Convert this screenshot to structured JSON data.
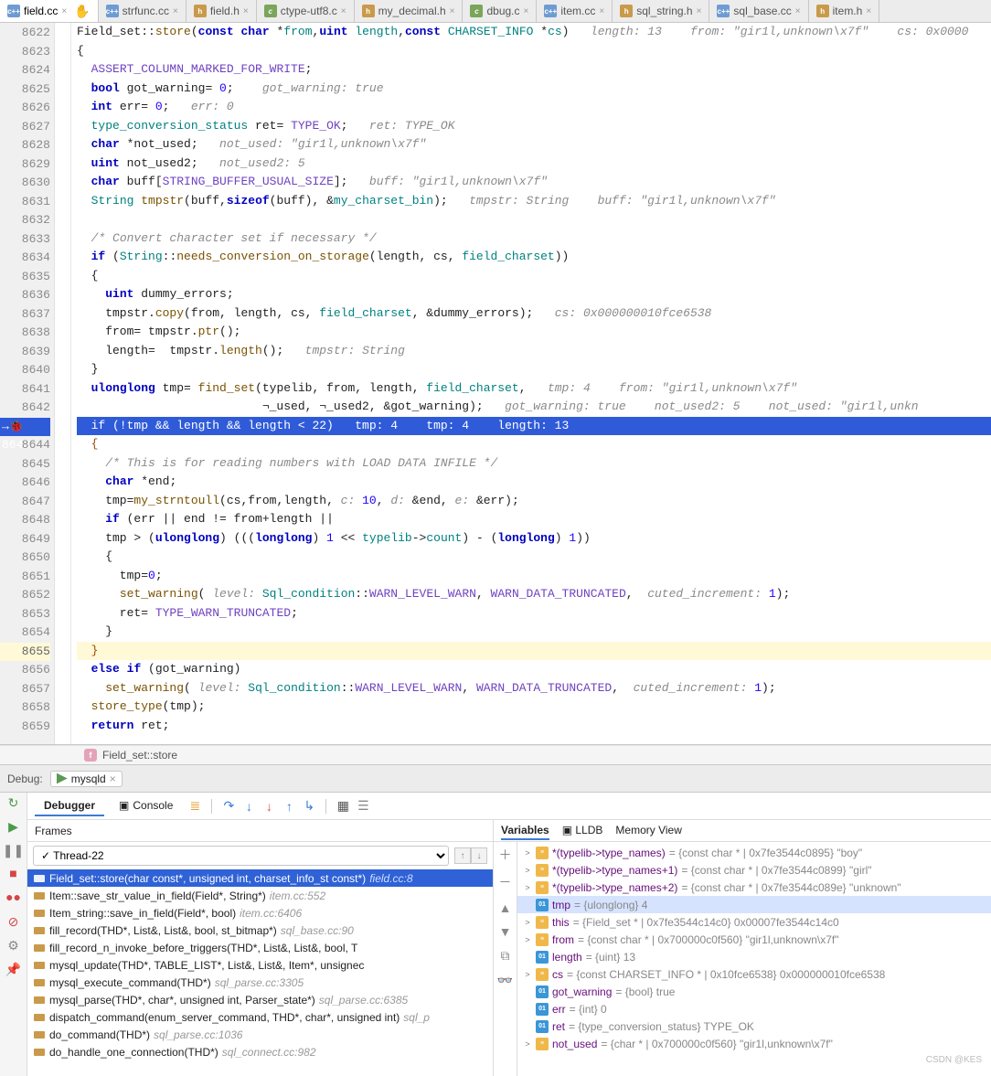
{
  "tabs": [
    {
      "kind": "cpp",
      "label": "field.cc",
      "mod": true,
      "active": true
    },
    {
      "kind": "cpp",
      "label": "strfunc.cc"
    },
    {
      "kind": "h",
      "label": "field.h"
    },
    {
      "kind": "c",
      "label": "ctype-utf8.c"
    },
    {
      "kind": "h",
      "label": "my_decimal.h"
    },
    {
      "kind": "c",
      "label": "dbug.c"
    },
    {
      "kind": "cpp",
      "label": "item.cc"
    },
    {
      "kind": "h",
      "label": "sql_string.h"
    },
    {
      "kind": "cpp",
      "label": "sql_base.cc"
    },
    {
      "kind": "h",
      "label": "item.h"
    }
  ],
  "lines": {
    "start": 8622,
    "count": 38,
    "highlight": 8643,
    "caret": 8655
  },
  "code": [
    {
      "h": "Field_set::<span class='fn'>store</span>(<span class='k'>const</span> <span class='k'>char</span> *<span class='t'>from</span>,<span class='k'>uint</span> <span class='t'>length</span>,<span class='k'>const</span> <span class='t'>CHARSET_INFO</span> *<span class='t'>cs</span>)   <span class='c'>length: 13</span>    <span class='c'>from: \"gir1l,unknown\\x7f\"</span>    <span class='c'>cs: 0x0000</span>"
    },
    {
      "h": "{"
    },
    {
      "h": "  <span class='m'>ASSERT_COLUMN_MARKED_FOR_WRITE</span>;"
    },
    {
      "h": "  <span class='k'>bool</span> got_warning= <span class='n'>0</span>;    <span class='c'>got_warning: true</span>"
    },
    {
      "h": "  <span class='k'>int</span> err= <span class='n'>0</span>;   <span class='c'>err: 0</span>"
    },
    {
      "h": "  <span class='t'>type_conversion_status</span> ret= <span class='m'>TYPE_OK</span>;   <span class='c'>ret: TYPE_OK</span>"
    },
    {
      "h": "  <span class='k'>char</span> *not_used;   <span class='c'>not_used: \"gir1l,unknown\\x7f\"</span>"
    },
    {
      "h": "  <span class='k'>uint</span> not_used2;   <span class='c'>not_used2: 5</span>"
    },
    {
      "h": "  <span class='k'>char</span> buff[<span class='m'>STRING_BUFFER_USUAL_SIZE</span>];   <span class='c'>buff: \"gir1l,unknown\\x7f\"</span>"
    },
    {
      "h": "  <span class='t'>String</span> <span class='fn'>tmpstr</span>(buff,<span class='k'>sizeof</span>(buff), &<span class='t'>my_charset_bin</span>);   <span class='c'>tmpstr: String</span>    <span class='c'>buff: \"gir1l,unknown\\x7f\"</span>"
    },
    {
      "h": " "
    },
    {
      "h": "  <span class='c'>/* Convert character set if necessary */</span>"
    },
    {
      "h": "  <span class='k'>if</span> (<span class='t'>String</span>::<span class='fn'>needs_conversion_on_storage</span>(length, cs, <span class='t'>field_charset</span>))"
    },
    {
      "h": "  {"
    },
    {
      "h": "    <span class='k'>uint</span> dummy_errors;"
    },
    {
      "h": "    tmpstr.<span class='fn'>copy</span>(from, length, cs, <span class='t'>field_charset</span>, &dummy_errors);   <span class='c'>cs: 0x000000010fce6538</span>"
    },
    {
      "h": "    from= tmpstr.<span class='fn'>ptr</span>();"
    },
    {
      "h": "    length=  tmpstr.<span class='fn'>length</span>();   <span class='c'>tmpstr: String</span>"
    },
    {
      "h": "  }"
    },
    {
      "h": "  <span class='k'>ulonglong</span> tmp= <span class='fn'>find_set</span>(typelib, from, length, <span class='t'>field_charset</span>,   <span class='c'>tmp: 4</span>    <span class='c'>from: \"gir1l,unknown\\x7f\"</span>"
    },
    {
      "h": "                          &not_used, &not_used2, &got_warning);   <span class='c'>got_warning: true</span>    <span class='c'>not_used2: 5</span>    <span class='c'>not_used: \"gir1l,unkn</span>"
    },
    {
      "h": "  if (!tmp && length && length < 22)   tmp: 4    tmp: 4    length: 13",
      "cls": "hl"
    },
    {
      "h": "  <span class='br'>{</span>"
    },
    {
      "h": "    <span class='c'>/* This is for reading numbers with LOAD DATA INFILE */</span>"
    },
    {
      "h": "    <span class='k'>char</span> *end;"
    },
    {
      "h": "    tmp=<span class='fn'>my_strntoull</span>(cs,from,length, <span class='c'>c:</span> <span class='n'>10</span>, <span class='c'>d:</span> &end, <span class='c'>e:</span> &err);"
    },
    {
      "h": "    <span class='k'>if</span> (err || end != from+length ||"
    },
    {
      "h": "    tmp > (<span class='k'>ulonglong</span>) (((<span class='k'>longlong</span>) <span class='n'>1</span> << <span class='t'>typelib</span>-&gt;<span class='t'>count</span>) - (<span class='k'>longlong</span>) <span class='n'>1</span>))"
    },
    {
      "h": "    {"
    },
    {
      "h": "      tmp=<span class='n'>0</span>;"
    },
    {
      "h": "      <span class='fn'>set_warning</span>( <span class='c'>level:</span> <span class='t'>Sql_condition</span>::<span class='m'>WARN_LEVEL_WARN</span>, <span class='m'>WARN_DATA_TRUNCATED</span>,  <span class='c'>cuted_increment:</span> <span class='n'>1</span>);"
    },
    {
      "h": "      ret= <span class='m'>TYPE_WARN_TRUNCATED</span>;"
    },
    {
      "h": "    }"
    },
    {
      "h": "  <span class='br'>}</span>",
      "cls": "yl"
    },
    {
      "h": "  <span class='k'>else</span> <span class='k'>if</span> (got_warning)"
    },
    {
      "h": "    <span class='fn'>set_warning</span>( <span class='c'>level:</span> <span class='t'>Sql_condition</span>::<span class='m'>WARN_LEVEL_WARN</span>, <span class='m'>WARN_DATA_TRUNCATED</span>,  <span class='c'>cuted_increment:</span> <span class='n'>1</span>);"
    },
    {
      "h": "  <span class='fn'>store_type</span>(tmp);"
    },
    {
      "h": "  <span class='k'>return</span> ret;"
    }
  ],
  "crumb": "Field_set::store",
  "debug": {
    "label": "Debug:",
    "config": "mysqld"
  },
  "dbgtabs": {
    "debugger": "Debugger",
    "console": "Console"
  },
  "frames": {
    "title": "Frames",
    "thread": "Thread-22",
    "rows": [
      {
        "sig": "Field_set::store(char const*, unsigned int, charset_info_st const*)",
        "loc": "field.cc:8",
        "sel": true
      },
      {
        "sig": "Item::save_str_value_in_field(Field*, String*)",
        "loc": "item.cc:552"
      },
      {
        "sig": "Item_string::save_in_field(Field*, bool)",
        "loc": "item.cc:6406"
      },
      {
        "sig": "fill_record(THD*, List<Item>&, List<Item>&, bool, st_bitmap*)",
        "loc": "sql_base.cc:90"
      },
      {
        "sig": "fill_record_n_invoke_before_triggers(THD*, List<Item>&, List<Item>&, bool, T",
        "loc": ""
      },
      {
        "sig": "mysql_update(THD*, TABLE_LIST*, List<Item>&, List<Item>&, Item*, unsignec",
        "loc": ""
      },
      {
        "sig": "mysql_execute_command(THD*)",
        "loc": "sql_parse.cc:3305"
      },
      {
        "sig": "mysql_parse(THD*, char*, unsigned int, Parser_state*)",
        "loc": "sql_parse.cc:6385"
      },
      {
        "sig": "dispatch_command(enum_server_command, THD*, char*, unsigned int)",
        "loc": "sql_p"
      },
      {
        "sig": "do_command(THD*)",
        "loc": "sql_parse.cc:1036"
      },
      {
        "sig": "do_handle_one_connection(THD*)",
        "loc": "sql_connect.cc:982"
      }
    ]
  },
  "vars": {
    "tabs": {
      "variables": "Variables",
      "lldb": "LLDB",
      "memory": "Memory View"
    },
    "rows": [
      {
        "ind": 0,
        "tw": ">",
        "ic": "obj",
        "name": "*(typelib->type_names)",
        "val": " = {const char * | 0x7fe3544c0895} \"boy\""
      },
      {
        "ind": 0,
        "tw": ">",
        "ic": "obj",
        "name": "*(typelib->type_names+1)",
        "val": " = {const char * | 0x7fe3544c0899} \"girl\""
      },
      {
        "ind": 0,
        "tw": ">",
        "ic": "obj",
        "name": "*(typelib->type_names+2)",
        "val": " = {const char * | 0x7fe3544c089e} \"unknown\""
      },
      {
        "ind": 0,
        "tw": "",
        "ic": "prim",
        "name": "tmp",
        "val": " = {ulonglong} 4",
        "sel": true
      },
      {
        "ind": 0,
        "tw": ">",
        "ic": "obj",
        "name": "this",
        "val": " = {Field_set * | 0x7fe3544c14c0} 0x00007fe3544c14c0"
      },
      {
        "ind": 0,
        "tw": ">",
        "ic": "obj",
        "name": "from",
        "val": " = {const char * | 0x700000c0f560} \"gir1l,unknown\\x7f\""
      },
      {
        "ind": 0,
        "tw": "",
        "ic": "prim",
        "name": "length",
        "val": " = {uint} 13"
      },
      {
        "ind": 0,
        "tw": ">",
        "ic": "obj",
        "name": "cs",
        "val": " = {const CHARSET_INFO * | 0x10fce6538} 0x000000010fce6538"
      },
      {
        "ind": 0,
        "tw": "",
        "ic": "prim",
        "name": "got_warning",
        "val": " = {bool} true"
      },
      {
        "ind": 0,
        "tw": "",
        "ic": "prim",
        "name": "err",
        "val": " = {int} 0"
      },
      {
        "ind": 0,
        "tw": "",
        "ic": "prim",
        "name": "ret",
        "val": " = {type_conversion_status} TYPE_OK"
      },
      {
        "ind": 0,
        "tw": ">",
        "ic": "obj",
        "name": "not_used",
        "val": " = {char * | 0x700000c0f560} \"gir1l,unknown\\x7f\""
      }
    ]
  },
  "watermark": "CSDN @KES"
}
